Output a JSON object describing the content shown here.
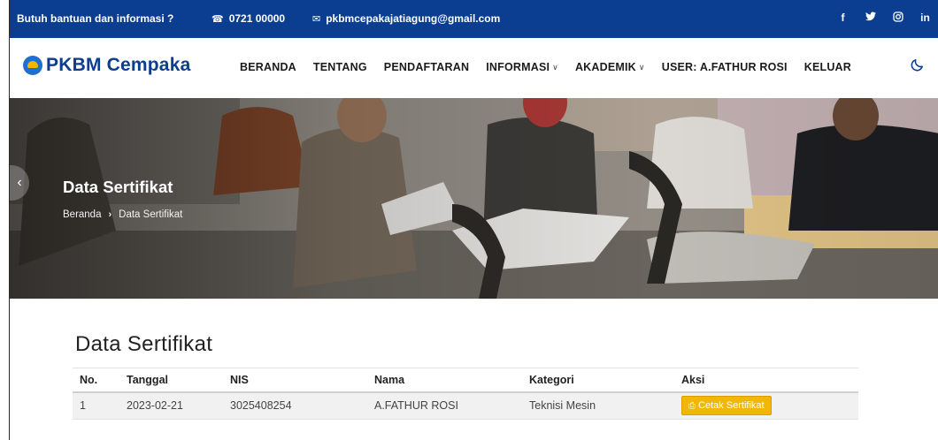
{
  "topbar": {
    "help_text": "Butuh bantuan dan informasi ?",
    "phone": "0721 00000",
    "email": "pkbmcepakajatiagung@gmail.com",
    "socials": [
      "f",
      "✓",
      "◎",
      "in"
    ]
  },
  "header": {
    "brand": "PKBM Cempaka",
    "nav": {
      "beranda": "BERANDA",
      "tentang": "TENTANG",
      "pendaftaran": "PENDAFTARAN",
      "informasi": "INFORMASI",
      "akademik": "AKADEMIK",
      "user": "USER: A.FATHUR ROSI",
      "keluar": "KELUAR"
    }
  },
  "hero": {
    "title": "Data Sertifikat",
    "breadcrumb_home": "Beranda",
    "breadcrumb_separator": "›",
    "breadcrumb_current": "Data Sertifikat"
  },
  "main": {
    "title": "Data Sertifikat",
    "table": {
      "headers": [
        "No.",
        "Tanggal",
        "NIS",
        "Nama",
        "Kategori",
        "Aksi"
      ],
      "rows": [
        {
          "no": "1",
          "tanggal": "2023-02-21",
          "nis": "3025408254",
          "nama": "A.FATHUR ROSI",
          "kategori": "Teknisi Mesin",
          "aksi_label": "Cetak Sertifikat"
        }
      ]
    }
  },
  "colors": {
    "topbar_bg": "#0b3d91",
    "brand": "#0b3d91",
    "button_accent": "#f2b705"
  }
}
